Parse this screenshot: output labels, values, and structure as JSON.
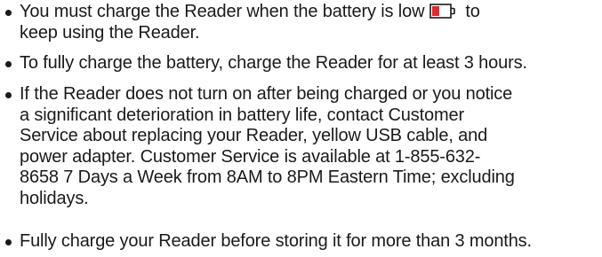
{
  "bullets": [
    {
      "lines": [
        "You must charge the Reader when the battery is low",
        "keep using the Reader."
      ],
      "after_icon": "to",
      "icon": "battery-low-icon"
    },
    {
      "lines": [
        "To fully charge the battery, charge the Reader for at least 3 hours."
      ]
    },
    {
      "lines": [
        "If the Reader does not turn on after being charged or you notice",
        "a significant deterioration in battery life, contact Customer",
        "Service about replacing your Reader, yellow USB cable, and",
        "power adapter. Customer Service is available at 1-855-632-",
        "8658 7 Days a Week from 8AM to 8PM Eastern Time; excluding",
        "holidays."
      ]
    },
    {
      "lines": [
        "Fully charge your Reader before storing it for more than 3 months."
      ]
    }
  ],
  "colors": {
    "text": "#1a1a1a",
    "battery_fill": "#e4282d",
    "battery_outline": "#1a1a1a"
  }
}
